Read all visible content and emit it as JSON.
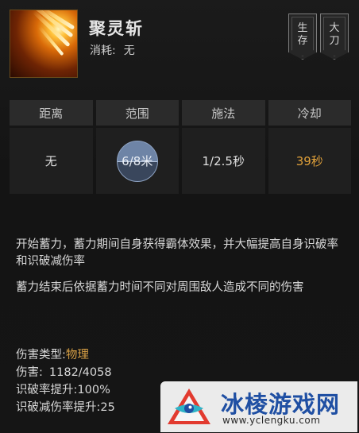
{
  "skill": {
    "name": "聚灵斩",
    "cost_label": "消耗:",
    "cost_value": "无",
    "tags": [
      {
        "line1": "生",
        "line2": "存"
      },
      {
        "line1": "大",
        "line2": "刀"
      }
    ],
    "icon": "slash-burst-icon"
  },
  "stats": {
    "headers": [
      "距离",
      "范围",
      "施法",
      "冷却"
    ],
    "distance": "无",
    "range": "6/8米",
    "cast": "1/2.5秒",
    "cooldown": "39秒",
    "cooldown_color": "#e1a13a"
  },
  "description": {
    "para1": "开始蓄力，蓄力期间自身获得霸体效果，并大幅提高自身识破率和识破减伤率",
    "para2": "蓄力结束后依据蓄力时间不同对周围敌人造成不同的伤害"
  },
  "attributes": [
    {
      "label": "伤害类型:",
      "value": "物理"
    },
    {
      "label": "伤害:",
      "value": "1182/4058"
    },
    {
      "label": "识破率提升:",
      "value": "100%"
    },
    {
      "label": "识破减伤率提升:",
      "value": "25"
    }
  ],
  "watermark": {
    "title": "冰棱游戏网",
    "url": "www.yclengku.com"
  }
}
